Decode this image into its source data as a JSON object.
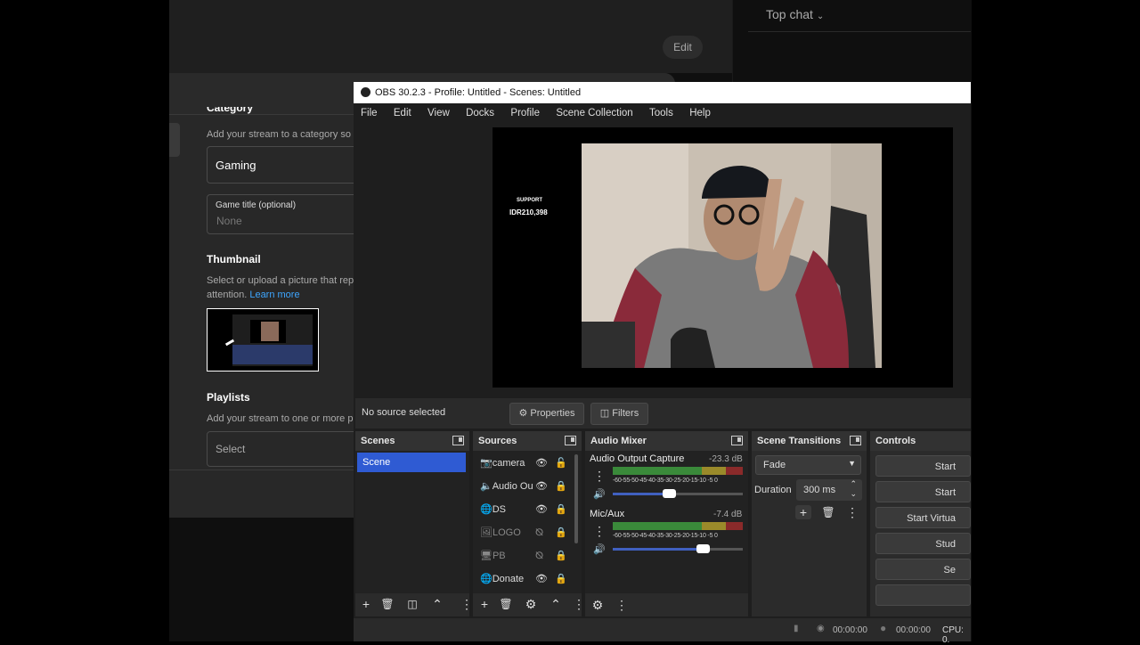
{
  "youtube": {
    "edit_label": "Edit",
    "top_chat_label": "Top chat",
    "category_heading": "Category",
    "category_sub": "Add your stream to a category so th",
    "category_value": "Gaming",
    "game_title_label": "Game title (optional)",
    "game_title_placeholder": "None",
    "thumbnail_heading": "Thumbnail",
    "thumbnail_sub1": "Select or upload a picture that repre",
    "thumbnail_sub2": "attention.",
    "learn_more": "Learn more",
    "playlists_heading": "Playlists",
    "playlists_sub": "Add your stream to one or more play",
    "playlists_select": "Select"
  },
  "obs": {
    "window_title": "OBS 30.2.3 - Profile: Untitled - Scenes: Untitled",
    "menu": [
      "File",
      "Edit",
      "View",
      "Docks",
      "Profile",
      "Scene Collection",
      "Tools",
      "Help"
    ],
    "overlay": {
      "support_label": "SUPPORT",
      "support_amount": "IDR210,398"
    },
    "source_bar": {
      "no_source": "No source selected",
      "properties": "Properties",
      "filters": "Filters"
    },
    "scenes": {
      "title": "Scenes",
      "items": [
        "Scene"
      ]
    },
    "sources": {
      "title": "Sources",
      "items": [
        {
          "name": "camera",
          "icon": "camera-icon",
          "visible": true,
          "locked": false
        },
        {
          "name": "Audio Ou",
          "icon": "speaker-icon",
          "visible": true,
          "locked": true
        },
        {
          "name": "DS",
          "icon": "globe-icon",
          "visible": true,
          "locked": true
        },
        {
          "name": "LOGO",
          "icon": "image-icon",
          "visible": false,
          "locked": true
        },
        {
          "name": "PB",
          "icon": "monitor-icon",
          "visible": false,
          "locked": true
        },
        {
          "name": "Donate",
          "icon": "globe-icon",
          "visible": true,
          "locked": true
        }
      ]
    },
    "mixer": {
      "title": "Audio Mixer",
      "ticks": "-60-55-50-45-40-35-30-25-20-15-10 -5  0",
      "channels": [
        {
          "name": "Audio Output Capture",
          "db": "-23.3 dB",
          "volume": 0.44
        },
        {
          "name": "Mic/Aux",
          "db": "-7.4 dB",
          "volume": 0.7
        }
      ]
    },
    "transitions": {
      "title": "Scene Transitions",
      "type": "Fade",
      "duration_label": "Duration",
      "duration_value": "300 ms"
    },
    "controls": {
      "title": "Controls",
      "buttons": [
        "Start",
        "Start",
        "Start Virtua",
        "Stud",
        "Se",
        ""
      ]
    },
    "status": {
      "rec_time": "00:00:00",
      "stream_time": "00:00:00",
      "cpu": "CPU: 0."
    },
    "colors": {
      "accent": "#2f5bd3",
      "titlebar": "#ffffff",
      "panel": "#2b2b2b"
    }
  }
}
